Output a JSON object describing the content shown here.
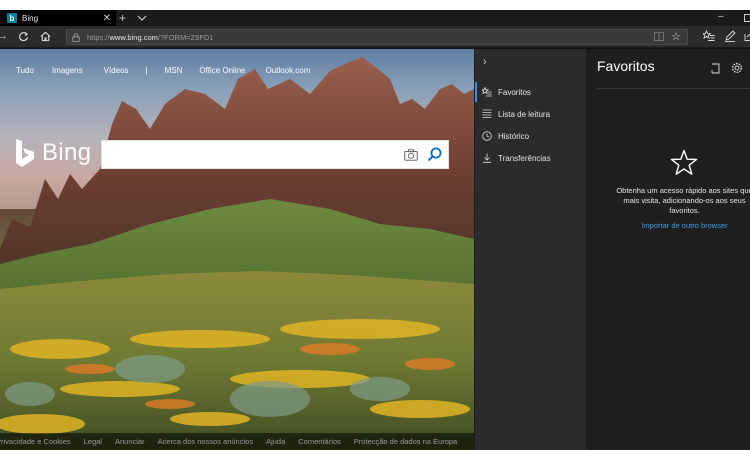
{
  "browser": {
    "tab": {
      "title": "Bing",
      "close_glyph": "✕",
      "favicon_letter": "b"
    },
    "new_tab_glyph": "+",
    "minimize_glyph": "–",
    "address": {
      "prefix": "https://",
      "host": "www.bing.com",
      "path": "/?FORM=Z9FD1"
    },
    "icons": [
      "forward-icon",
      "refresh-icon",
      "home-icon",
      "lock-icon",
      "reading-view-icon",
      "favorite-star-icon",
      "hub-icon",
      "web-note-icon",
      "share-icon"
    ]
  },
  "bing": {
    "top_nav": [
      "Tudo",
      "Imagens",
      "Vídeos",
      "|",
      "MSN",
      "Office Online",
      "Outlook.com"
    ],
    "logo_text": "Bing",
    "search_placeholder": "",
    "footer_links": [
      "Privacidade e Cookies",
      "Legal",
      "Anunciar",
      "Acerca dos nossos anúncios",
      "Ajuda",
      "Comentários",
      "Protecção de dados na Europa"
    ]
  },
  "hub": {
    "collapse_glyph": "›",
    "items": [
      {
        "label": "Favoritos",
        "icon": "favorites-icon",
        "active": true
      },
      {
        "label": "Lista de leitura",
        "icon": "reading-list-icon",
        "active": false
      },
      {
        "label": "Histórico",
        "icon": "history-icon",
        "active": false
      },
      {
        "label": "Transferências",
        "icon": "downloads-icon",
        "active": false
      }
    ]
  },
  "favorites_pane": {
    "title": "Favoritos",
    "empty_message": "Obtenha um acesso rápido aos sites que mais visita, adicionando-os aos seus favoritos.",
    "import_link": "Importar de outro browser"
  },
  "colors": {
    "accent": "#3a9ee6",
    "bing_teal": "#00809d",
    "pane_bg": "#1f1f1f",
    "hub_bg": "#2b2b2b"
  }
}
